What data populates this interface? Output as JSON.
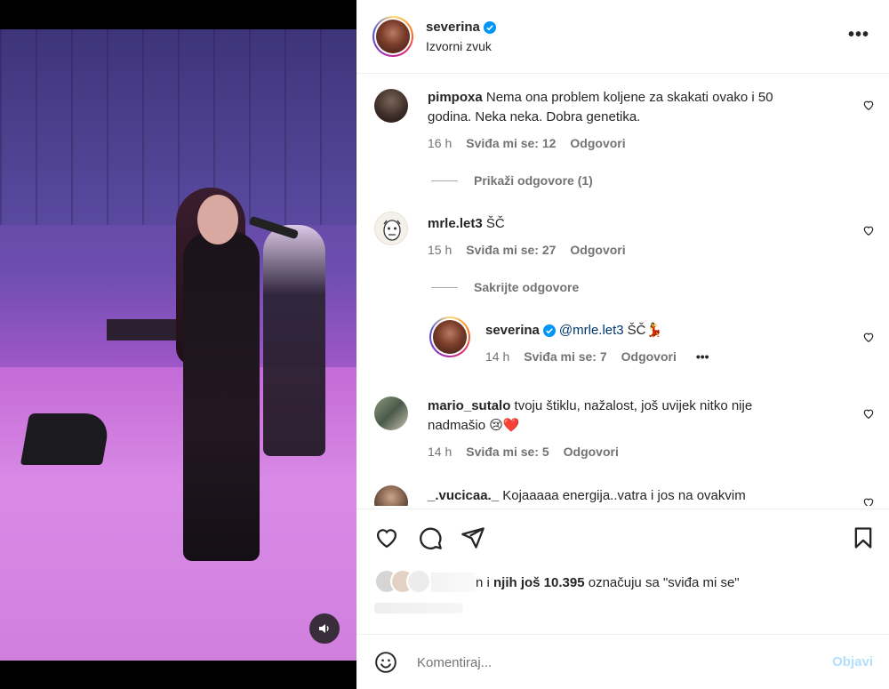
{
  "post": {
    "username": "severina",
    "audio": "Izvorni zvuk",
    "more_label": "•••"
  },
  "comments": [
    {
      "username": "pimpoxa",
      "text": "Nema ona problem koljene za skakati ovako i 50",
      "text2": "godina. Neka neka. Dobra genetika.",
      "time": "16 h",
      "likes": "Sviđa mi se: 12",
      "reply": "Odgovori",
      "toggle": "Prikaži odgovore (1)"
    },
    {
      "username": "mrle.let3",
      "text": "ŠČ",
      "time": "15 h",
      "likes": "Sviđa mi se: 27",
      "reply": "Odgovori",
      "toggle": "Sakrijte odgovore"
    },
    {
      "username": "severina",
      "mention": "@mrle.let3",
      "text": "ŠČ💃",
      "time": "14 h",
      "likes": "Sviđa mi se: 7",
      "reply": "Odgovori",
      "more": "•••"
    },
    {
      "username": "mario_sutalo",
      "text": "tvoju štiklu, nažalost, još uvijek nitko nije",
      "text2": "nadmašio 😢❤️",
      "time": "14 h",
      "likes": "Sviđa mi se: 5",
      "reply": "Odgovori"
    },
    {
      "username": "_.vucicaa._",
      "text": "Kojaaaaa energija..vatra i jos na ovakvim"
    }
  ],
  "likes_summary": {
    "prefix": "n i ",
    "bold": "njih još 10.395",
    "suffix": " označuju sa \"sviđa mi se\""
  },
  "composer": {
    "placeholder": "Komentiraj...",
    "post_label": "Objavi"
  },
  "colors": {
    "verified": "#0095f6",
    "heart_red": "#ed4956",
    "muted": "#737373"
  }
}
